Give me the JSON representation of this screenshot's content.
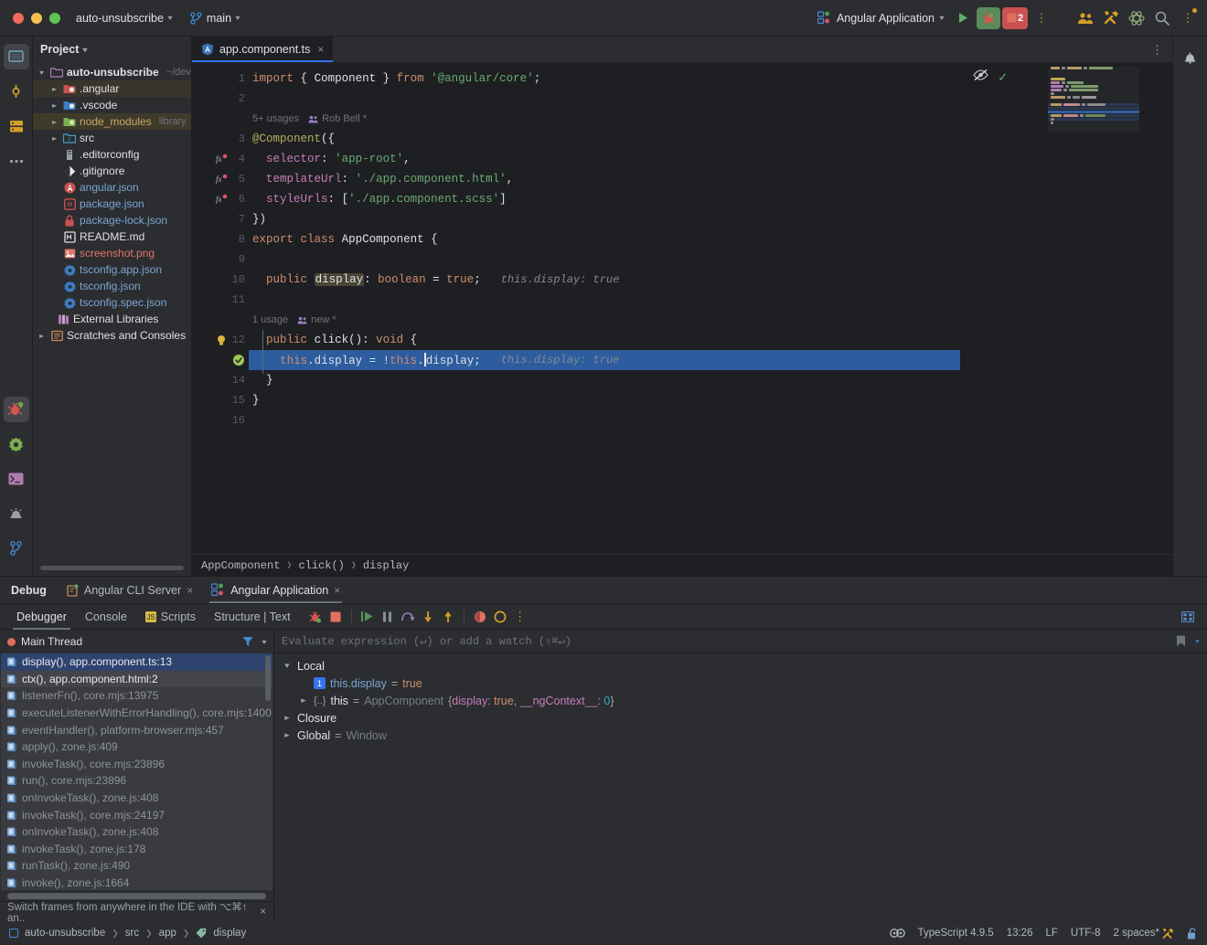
{
  "titlebar": {
    "project_name": "auto-unsubscribe",
    "branch": "main",
    "branch_icon": "git-branch-icon",
    "run_config": "Angular Application",
    "run_icon": "run-play-icon",
    "debug_icon": "debug-bug-icon",
    "stop_count": "2",
    "more_icon": "more-vertical-icon",
    "icons": [
      {
        "name": "people-icon",
        "glyph": "👥"
      },
      {
        "name": "tools-icon",
        "glyph": "tools"
      },
      {
        "name": "atom-icon",
        "glyph": "atom"
      },
      {
        "name": "search-icon",
        "glyph": "search"
      },
      {
        "name": "settings-more-icon",
        "glyph": "more"
      }
    ]
  },
  "rail": {
    "top": [
      {
        "name": "project-tool-icon",
        "label": "Project"
      },
      {
        "name": "commit-icon",
        "label": "Commit"
      },
      {
        "name": "database-icon",
        "label": "Database"
      },
      {
        "name": "more-tools-icon",
        "label": "More tool windows"
      }
    ],
    "bottom": [
      {
        "name": "debug-tool-icon",
        "label": "Debug"
      },
      {
        "name": "settings-gear-icon",
        "label": "Settings"
      },
      {
        "name": "terminal-icon",
        "label": "Terminal"
      },
      {
        "name": "problems-icon",
        "label": "Problems"
      },
      {
        "name": "git-icon",
        "label": "Git"
      }
    ]
  },
  "project": {
    "header": "Project",
    "header_chevron": "chevron-down-icon",
    "tree": [
      {
        "depth": 0,
        "arrow": "down",
        "icon": "folder-module-icon",
        "label": "auto-unsubscribe",
        "bold": true,
        "sub": "~/dev",
        "hl": ""
      },
      {
        "depth": 1,
        "arrow": "right",
        "icon": "folder-excluded-icon",
        "label": ".angular",
        "bold": false,
        "sub": "",
        "hl": "hl1"
      },
      {
        "depth": 1,
        "arrow": "right",
        "icon": "folder-vscode-icon",
        "label": ".vscode",
        "bold": false,
        "sub": "",
        "hl": ""
      },
      {
        "depth": 1,
        "arrow": "right",
        "icon": "folder-library-icon",
        "label": "node_modules",
        "bold": false,
        "sub": "library",
        "hl": "hl2"
      },
      {
        "depth": 1,
        "arrow": "right",
        "icon": "folder-source-icon",
        "label": "src",
        "bold": false,
        "sub": "",
        "hl": ""
      },
      {
        "depth": 1,
        "arrow": "none",
        "icon": "editorconfig-icon",
        "label": ".editorconfig",
        "bold": false,
        "sub": "",
        "hl": ""
      },
      {
        "depth": 1,
        "arrow": "none",
        "icon": "gitignore-icon",
        "label": ".gitignore",
        "bold": false,
        "sub": "",
        "hl": ""
      },
      {
        "depth": 1,
        "arrow": "none",
        "icon": "angular-json-icon",
        "label": "angular.json",
        "bold": false,
        "sub": "",
        "hl": ""
      },
      {
        "depth": 1,
        "arrow": "none",
        "icon": "package-json-icon",
        "label": "package.json",
        "bold": false,
        "sub": "",
        "hl": ""
      },
      {
        "depth": 1,
        "arrow": "none",
        "icon": "lock-icon",
        "label": "package-lock.json",
        "bold": false,
        "sub": "",
        "hl": ""
      },
      {
        "depth": 1,
        "arrow": "none",
        "icon": "markdown-icon",
        "label": "README.md",
        "bold": false,
        "sub": "",
        "hl": ""
      },
      {
        "depth": 1,
        "arrow": "none",
        "icon": "image-icon",
        "label": "screenshot.png",
        "bold": false,
        "sub": "",
        "hl": ""
      },
      {
        "depth": 1,
        "arrow": "none",
        "icon": "tsconfig-icon",
        "label": "tsconfig.app.json",
        "bold": false,
        "sub": "",
        "hl": ""
      },
      {
        "depth": 1,
        "arrow": "none",
        "icon": "tsconfig-icon",
        "label": "tsconfig.json",
        "bold": false,
        "sub": "",
        "hl": ""
      },
      {
        "depth": 1,
        "arrow": "none",
        "icon": "tsconfig-icon",
        "label": "tsconfig.spec.json",
        "bold": false,
        "sub": "",
        "hl": ""
      },
      {
        "depth": 0.5,
        "arrow": "none",
        "icon": "external-libraries-icon",
        "label": "External Libraries",
        "bold": false,
        "sub": "",
        "hl": ""
      },
      {
        "depth": 0,
        "arrow": "right",
        "icon": "scratches-icon",
        "label": "Scratches and Consoles",
        "bold": false,
        "sub": "",
        "hl": ""
      }
    ]
  },
  "editor": {
    "tab": {
      "label": "app.component.ts",
      "icon": "angular-file-icon",
      "close": "×"
    },
    "more_icon": "editor-more-icon",
    "gutter_icons": {
      "fx": "fx-marker-icon",
      "bulb": "intention-bulb-icon",
      "breakpoint_hit": "breakpoint-verified-icon"
    },
    "lines": [
      {
        "num": "1",
        "mark": "",
        "type": "code",
        "text": "import { Component } from '@angular/core';"
      },
      {
        "num": "2",
        "mark": "",
        "type": "code",
        "text": ""
      },
      {
        "num": "",
        "mark": "",
        "type": "usage",
        "usages": "5+ usages",
        "author": "Rob Bell *"
      },
      {
        "num": "3",
        "mark": "",
        "type": "code",
        "text": "@Component({"
      },
      {
        "num": "4",
        "mark": "fx",
        "type": "code",
        "text": "  selector: 'app-root',"
      },
      {
        "num": "5",
        "mark": "fx",
        "type": "code",
        "text": "  templateUrl: './app.component.html',"
      },
      {
        "num": "6",
        "mark": "fx",
        "type": "code",
        "text": "  styleUrls: ['./app.component.scss']"
      },
      {
        "num": "7",
        "mark": "",
        "type": "code",
        "text": "})"
      },
      {
        "num": "8",
        "mark": "",
        "type": "code",
        "text": "export class AppComponent {"
      },
      {
        "num": "9",
        "mark": "",
        "type": "code",
        "text": ""
      },
      {
        "num": "10",
        "mark": "",
        "type": "code",
        "text": "  public display: boolean = true;",
        "hint": "this.display: true"
      },
      {
        "num": "11",
        "mark": "",
        "type": "code",
        "text": ""
      },
      {
        "num": "",
        "mark": "",
        "type": "usage",
        "usages": "1 usage",
        "author": "new *"
      },
      {
        "num": "12",
        "mark": "bulb",
        "type": "code",
        "text": "  public click(): void {"
      },
      {
        "num": "13",
        "mark": "bp",
        "type": "code",
        "text": "    this.display = !this.display;",
        "hint": "this.display: true",
        "current": true
      },
      {
        "num": "14",
        "mark": "",
        "type": "code",
        "text": "  }"
      },
      {
        "num": "15",
        "mark": "",
        "type": "code",
        "text": "}"
      },
      {
        "num": "16",
        "mark": "",
        "type": "code",
        "text": ""
      }
    ],
    "inspection": {
      "eye_icon": "inspections-off-icon",
      "check_icon": "no-problems-checkmark-icon"
    },
    "breadcrumb": [
      "AppComponent",
      "click()",
      "display"
    ]
  },
  "debug": {
    "title": "Debug",
    "tabs": [
      {
        "label": "Angular CLI Server",
        "icon": "cli-server-icon",
        "active": false,
        "close": "×"
      },
      {
        "label": "Angular Application",
        "icon": "angular-app-icon",
        "active": true,
        "close": "×"
      }
    ],
    "subtabs": [
      {
        "label": "Debugger",
        "active": true,
        "icon": ""
      },
      {
        "label": "Console",
        "active": false,
        "icon": ""
      },
      {
        "label": "Scripts",
        "active": false,
        "icon": "scripts-js-icon"
      },
      {
        "label": "Structure | Text",
        "active": false,
        "icon": ""
      }
    ],
    "toolbar_icons": [
      {
        "name": "rerun-debug-icon"
      },
      {
        "name": "stop-icon"
      },
      {
        "name": "resume-program-icon"
      },
      {
        "name": "pause-program-icon"
      },
      {
        "name": "step-over-icon"
      },
      {
        "name": "step-into-icon"
      },
      {
        "name": "step-out-icon"
      },
      {
        "name": "mute-breakpoints-icon"
      },
      {
        "name": "view-breakpoints-icon"
      },
      {
        "name": "debug-more-icon"
      }
    ],
    "layout_icon": "restore-layout-icon",
    "thread": {
      "label": "Main Thread",
      "filter_icon": "filter-icon",
      "chevron": "chevron-down-icon"
    },
    "frames": [
      {
        "label": "display(), app.component.ts:13",
        "state": "sel"
      },
      {
        "label": "ctx(), app.component.html:2",
        "state": "sel2"
      },
      {
        "label": "listenerFn(), core.mjs:13975",
        "state": ""
      },
      {
        "label": "executeListenerWithErrorHandling(), core.mjs:1400",
        "state": ""
      },
      {
        "label": "eventHandler(), platform-browser.mjs:457",
        "state": ""
      },
      {
        "label": "apply(), zone.js:409",
        "state": ""
      },
      {
        "label": "invokeTask(), core.mjs:23896",
        "state": ""
      },
      {
        "label": "run(), core.mjs:23896",
        "state": ""
      },
      {
        "label": "onInvokeTask(), zone.js:408",
        "state": ""
      },
      {
        "label": "invokeTask(), core.mjs:24197",
        "state": ""
      },
      {
        "label": "onInvokeTask(), zone.js:408",
        "state": ""
      },
      {
        "label": "invokeTask(), zone.js:178",
        "state": ""
      },
      {
        "label": "runTask(), zone.js:490",
        "state": ""
      },
      {
        "label": "invoke(), zone.js:1664",
        "state": ""
      }
    ],
    "frames_hint": "Switch frames from anywhere in the IDE with ⌥⌘↑ an..",
    "frames_hint_close": "×",
    "watch_placeholder": "Evaluate expression (↵) or add a watch (⇧⌘↵)",
    "watch_icons": [
      {
        "name": "add-watch-bookmark-icon"
      },
      {
        "name": "chevron-down-icon"
      }
    ],
    "variables": [
      {
        "depth": 0,
        "arrow": "down",
        "badge": "",
        "name": "Local",
        "eq": "",
        "value": "",
        "vtype": ""
      },
      {
        "depth": 1,
        "arrow": "none",
        "badge": "1",
        "name": "this.display",
        "eq": "=",
        "value": "true",
        "vtype": "bool"
      },
      {
        "depth": 1,
        "arrow": "right",
        "badge": "{..}",
        "name": "this",
        "eq": "=",
        "value": "AppComponent",
        "vtype": "obj",
        "detail": "{display: true, __ngContext__: 0}"
      },
      {
        "depth": 0,
        "arrow": "right",
        "badge": "",
        "name": "Closure",
        "eq": "",
        "value": "",
        "vtype": ""
      },
      {
        "depth": 0,
        "arrow": "right",
        "badge": "",
        "name": "Global",
        "eq": "=",
        "value": "Window",
        "vtype": "gray"
      }
    ]
  },
  "statusbar": {
    "breadcrumb": [
      "auto-unsubscribe",
      "src",
      "app",
      "display"
    ],
    "breadcrumb_icon": "module-icon",
    "tag_icon": "tag-icon",
    "right": [
      {
        "name": "git-blame-icon",
        "label": ""
      },
      {
        "name": "language-level",
        "label": "TypeScript 4.9.5"
      },
      {
        "name": "caret-position",
        "label": "13:26"
      },
      {
        "name": "line-separator",
        "label": "LF"
      },
      {
        "name": "file-encoding",
        "label": "UTF-8"
      },
      {
        "name": "indent-setting",
        "label": "2 spaces*"
      },
      {
        "name": "tools-wrench-icon",
        "label": ""
      },
      {
        "name": "lock-unlocked-icon",
        "label": ""
      }
    ]
  },
  "notification": {
    "bell_icon": "notifications-bell-icon"
  }
}
